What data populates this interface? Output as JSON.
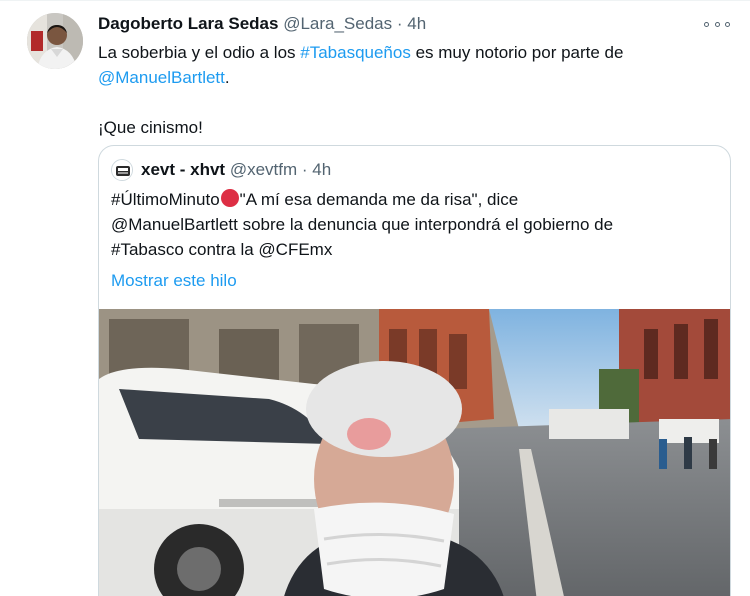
{
  "tweet": {
    "display_name": "Dagoberto Lara Sedas",
    "handle": "@Lara_Sedas",
    "separator": "·",
    "time": "4h",
    "text_line1_before": "La soberbia y el odio a los ",
    "text_line1_hashtag": "#Tabasqueños",
    "text_line1_after": " es muy notorio por parte de",
    "text_line2_mention": "@ManuelBartlett",
    "text_line2_after": ".",
    "text_line3": "¡Que cinismo!"
  },
  "quoted": {
    "display_name": "xevt - xhvt",
    "handle": "@xevtfm",
    "separator": "·",
    "time": "4h",
    "line1_before": "#ÚltimoMinuto",
    "line1_after": "\"A mí esa demanda me da risa\", dice",
    "line2": "@ManuelBartlett sobre la denuncia que interpondrá el gobierno de",
    "line3": "#Tabasco contra la @CFEmx",
    "show_thread": "Mostrar este hilo"
  },
  "icons": {
    "more": "more-horizontal-icon",
    "emoji": "red-circle-emoji"
  },
  "colors": {
    "link": "#1d9bf0",
    "text": "#0f1419",
    "secondary": "#536471",
    "border": "#cfd9de",
    "red_circle": "#dd2e44"
  }
}
